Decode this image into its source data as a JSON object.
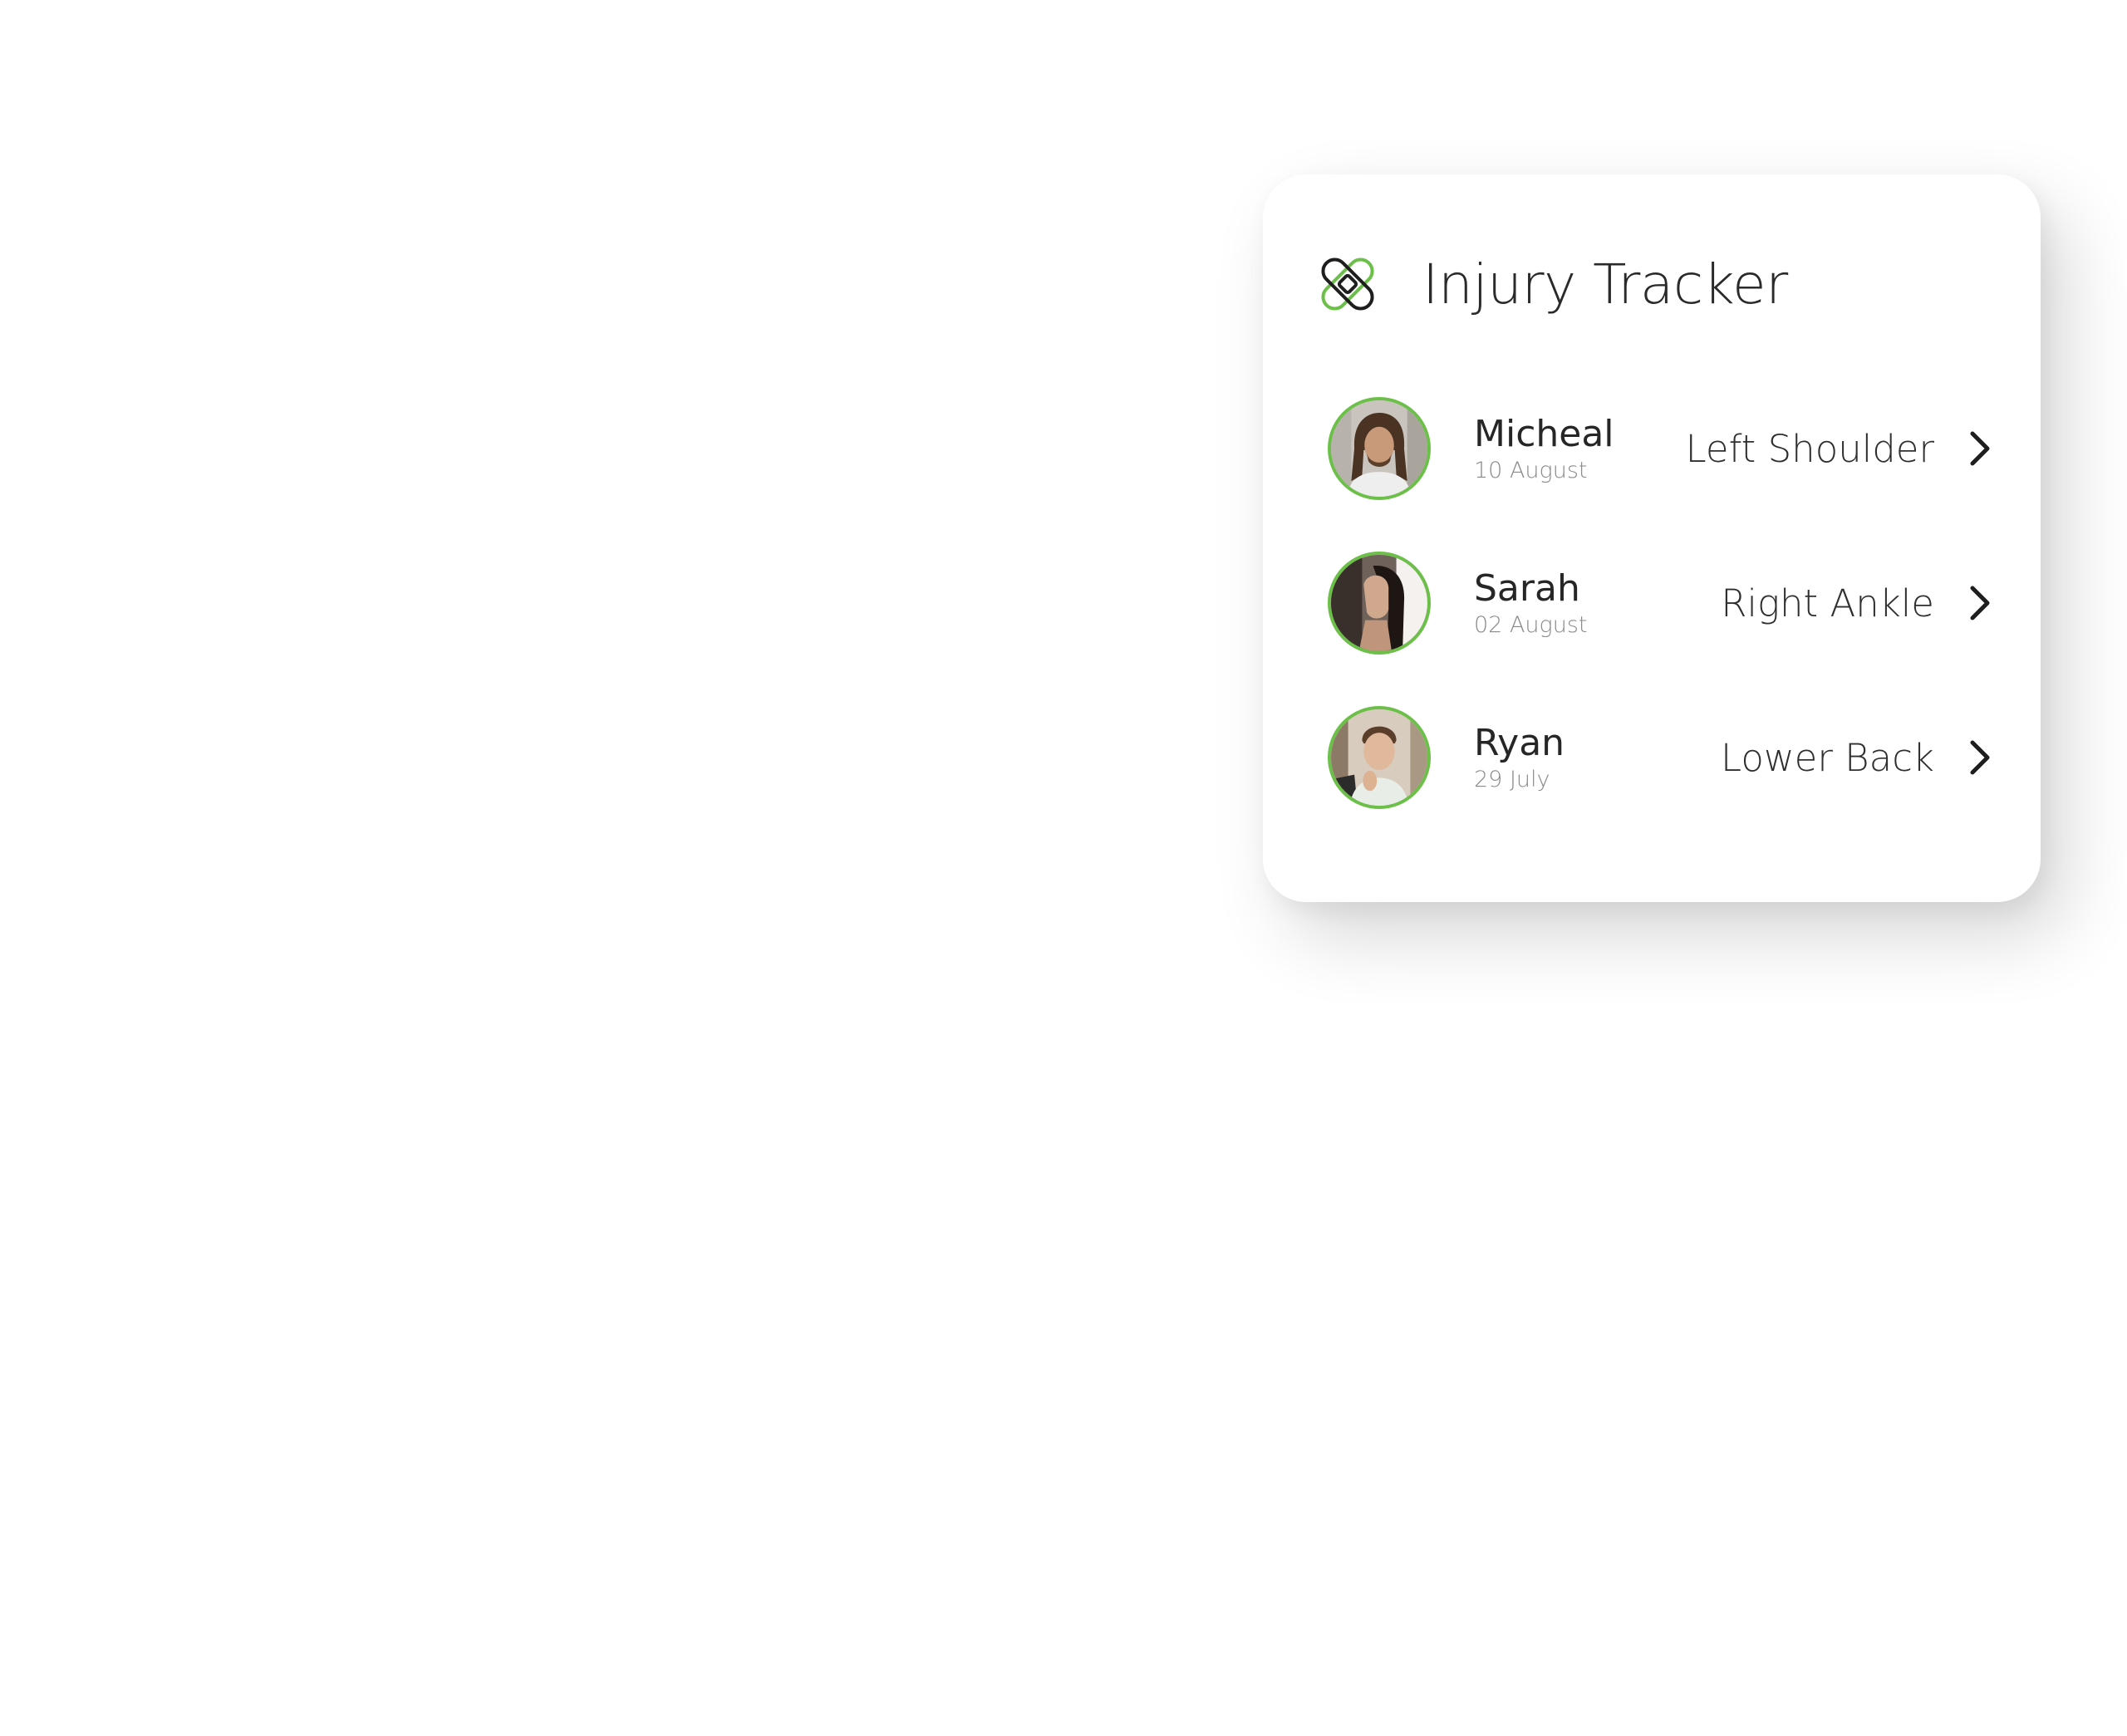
{
  "widget": {
    "title": "Injury Tracker",
    "icon": "bandage-icon",
    "accent_color": "#6cc04a"
  },
  "injuries": [
    {
      "name": "Micheal",
      "date": "10 August",
      "injury": "Left Shoulder",
      "icon": "chevron-right-icon"
    },
    {
      "name": "Sarah",
      "date": "02 August",
      "injury": "Right Ankle",
      "icon": "chevron-right-icon"
    },
    {
      "name": "Ryan",
      "date": "29 July",
      "injury": "Lower Back",
      "icon": "chevron-right-icon"
    }
  ]
}
